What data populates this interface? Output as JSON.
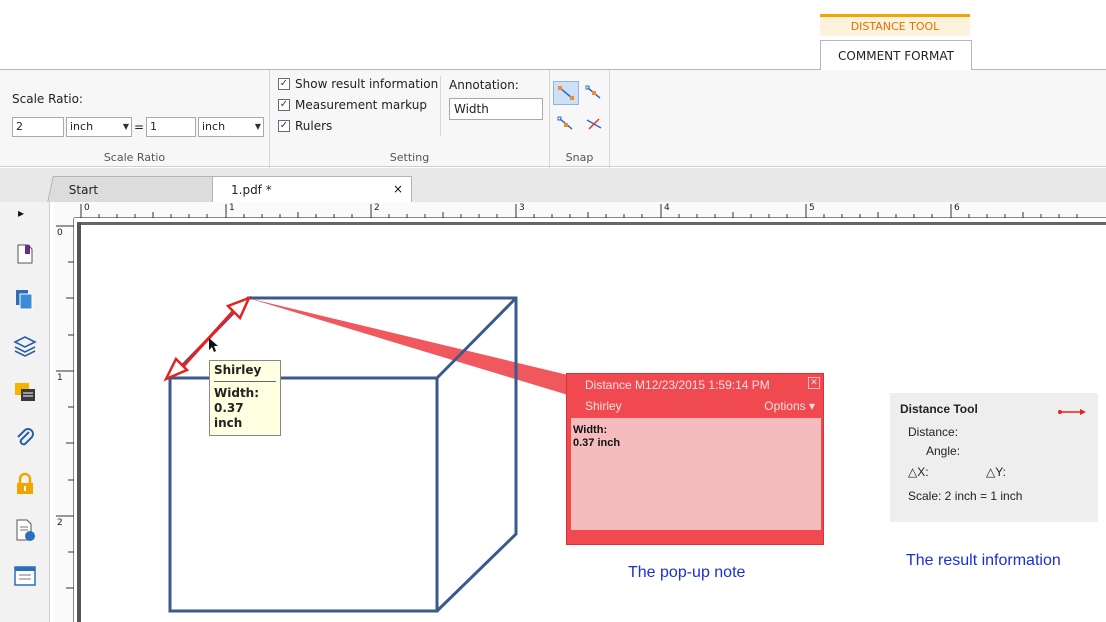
{
  "context_tab": {
    "group": "DISTANCE TOOL",
    "tab": "COMMENT FORMAT"
  },
  "ribbon": {
    "scale_ratio": {
      "title": "Scale Ratio:",
      "left_value": "2",
      "left_unit": "inch",
      "equals": "=",
      "right_value": "1",
      "right_unit": "inch",
      "group_label": "Scale Ratio"
    },
    "setting": {
      "checkboxes": [
        {
          "label": "Show result information",
          "checked": true
        },
        {
          "label": "Measurement markup",
          "checked": true
        },
        {
          "label": "Rulers",
          "checked": true
        }
      ],
      "annotation_label": "Annotation:",
      "annotation_value": "Width",
      "group_label": "Setting"
    },
    "snap": {
      "group_label": "Snap",
      "icons": [
        "snap-endpoint-icon",
        "snap-midpoint-icon",
        "snap-center-icon",
        "snap-intersection-icon"
      ]
    }
  },
  "tabs": {
    "start": "Start",
    "file": "1.pdf *",
    "close": "×"
  },
  "nav_arrow": "▸",
  "ruler": {
    "h": [
      "0",
      "1",
      "2",
      "3",
      "4",
      "5",
      "6"
    ],
    "v": [
      "0",
      "1",
      "2"
    ]
  },
  "tooltip": {
    "author": "Shirley",
    "line1": "Width:",
    "line2": "0.37 inch"
  },
  "popup": {
    "title": "Distance M",
    "date": "12/23/2015 1:59:14 PM",
    "author": "Shirley",
    "options": "Options ▾",
    "line1": "Width:",
    "line2": "0.37 inch"
  },
  "captions": {
    "popup": "The pop-up note",
    "result": "The result information"
  },
  "result": {
    "title": "Distance Tool",
    "distance": "Distance:",
    "angle": "Angle:",
    "dx": "△X:",
    "dy": "△Y:",
    "scale": "Scale:  2 inch = 1 inch"
  },
  "colors": {
    "accent": "#f0a500",
    "annotation": "#f04a50",
    "cube": "#3a5a8c",
    "caption": "#1a2fd6"
  }
}
